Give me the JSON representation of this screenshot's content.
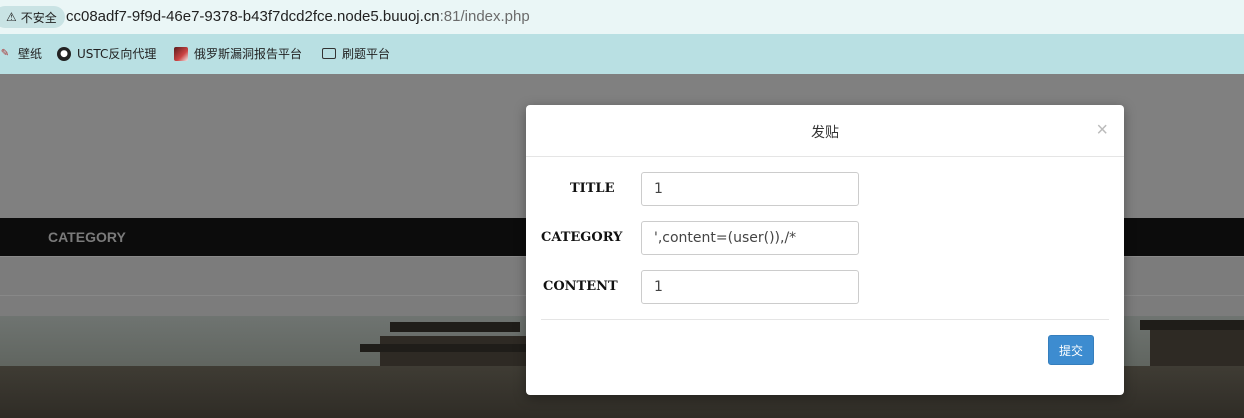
{
  "browser": {
    "insecure_label": "不安全",
    "url_host": "cc08adf7-9f9d-46e7-9378-b43f7dcd2fce.node5.buuoj.cn",
    "url_rest": ":81/index.php"
  },
  "bookmarks": [
    {
      "label": "壁纸",
      "icon": "wallpaper-icon"
    },
    {
      "label": "USTC反向代理",
      "icon": "globe-icon"
    },
    {
      "label": "俄罗斯漏洞报告平台",
      "icon": "avatar-icon"
    },
    {
      "label": "刷题平台",
      "icon": "folder-icon"
    }
  ],
  "page": {
    "nav_category": "CATEGORY"
  },
  "modal": {
    "title": "发贴",
    "close_symbol": "×",
    "fields": [
      {
        "label": "TITLE",
        "value": "1"
      },
      {
        "label": "CATEGORY",
        "value": "',content=(user()),/*"
      },
      {
        "label": "CONTENT",
        "value": "1"
      }
    ],
    "submit_label": "提交"
  },
  "colors": {
    "bookmarks_bg": "#b9e0e3",
    "submit_bg": "#3d8cd0",
    "navbar_bg": "#0c0c0c"
  }
}
